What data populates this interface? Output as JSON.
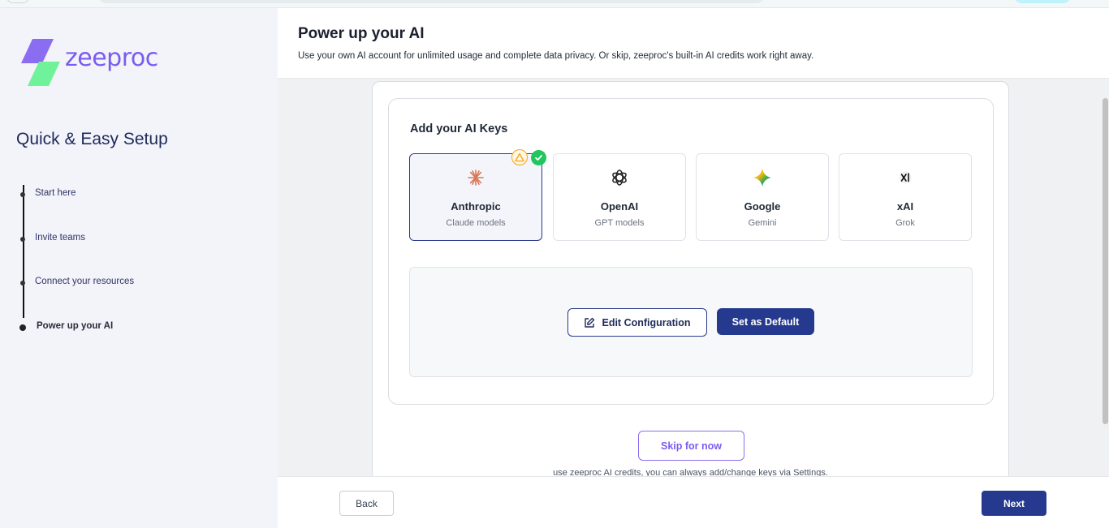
{
  "brand": {
    "name": "zeeproc",
    "color": "#7b5cf0",
    "accent_green": "#5ef08f"
  },
  "sidebar": {
    "title": "Quick & Easy Setup",
    "steps": [
      {
        "label": "Start here",
        "active": false
      },
      {
        "label": "Invite teams",
        "active": false
      },
      {
        "label": "Connect your resources",
        "active": false
      },
      {
        "label": "Power up your AI",
        "active": true
      }
    ]
  },
  "header": {
    "title": "Power up your AI",
    "subtitle": "Use your own AI account for unlimited usage and complete data privacy. Or skip, zeeproc's built-in AI credits work right away."
  },
  "keys": {
    "title": "Add your AI Keys",
    "providers": [
      {
        "name": "Anthropic",
        "desc": "Claude models",
        "icon": "anthropic-icon",
        "selected": true
      },
      {
        "name": "OpenAI",
        "desc": "GPT models",
        "icon": "openai-icon",
        "selected": false
      },
      {
        "name": "Google",
        "desc": "Gemini",
        "icon": "gemini-icon",
        "selected": false
      },
      {
        "name": "xAI",
        "desc": "Grok",
        "icon": "xai-icon",
        "selected": false
      }
    ],
    "edit_label": "Edit Configuration",
    "default_label": "Set as Default"
  },
  "skip": {
    "label": "Skip for now",
    "note": "use zeeproc AI credits, you can always add/change keys via Settings."
  },
  "footer": {
    "back_label": "Back",
    "next_label": "Next"
  },
  "colors": {
    "primary": "#253a8e",
    "warning": "#f0a61b",
    "success": "#22c55e"
  }
}
